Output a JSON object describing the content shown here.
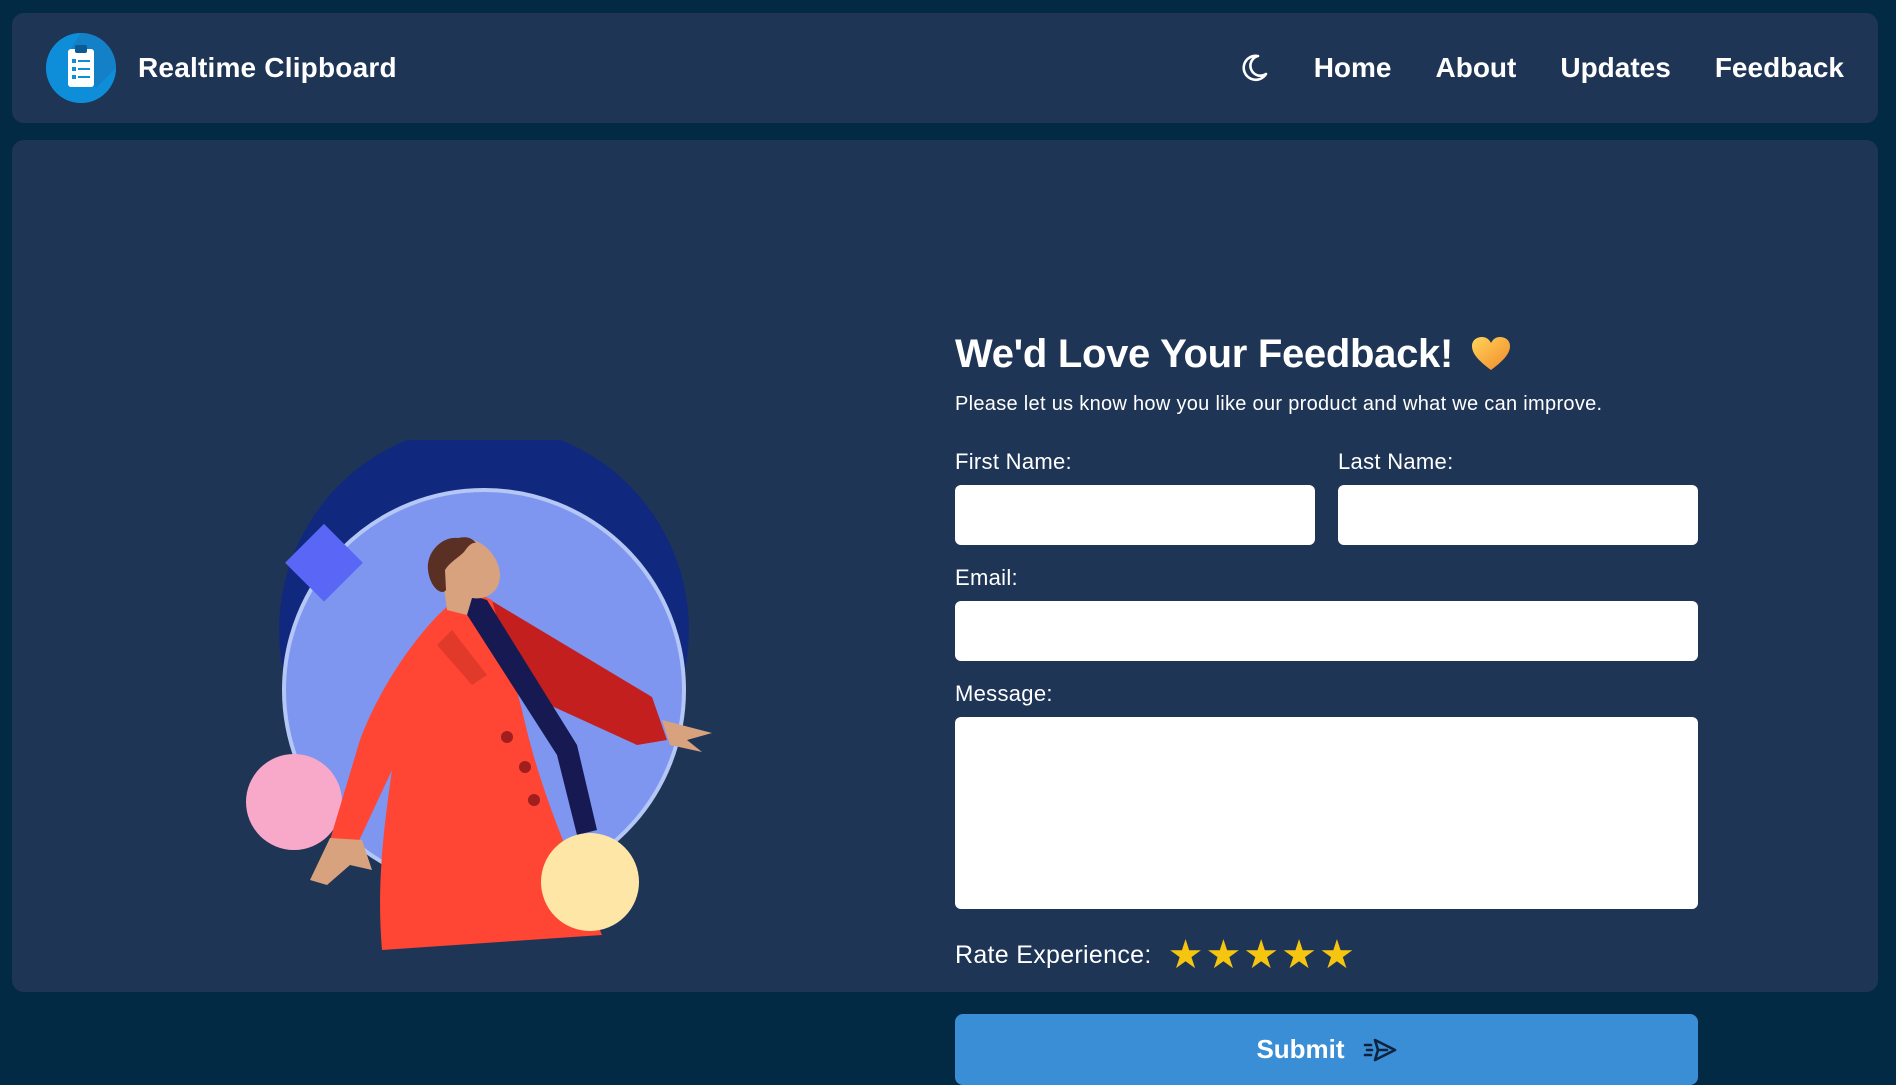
{
  "header": {
    "brand_name": "Realtime Clipboard",
    "nav": [
      {
        "label": "Home"
      },
      {
        "label": "About"
      },
      {
        "label": "Updates"
      },
      {
        "label": "Feedback"
      }
    ],
    "theme_toggle_icon": "moon-icon",
    "logo_icon": "clipboard-icon"
  },
  "form": {
    "title": "We'd Love Your Feedback!",
    "title_icon": "heart-icon",
    "subtitle": "Please let us know how you like our product and what we can improve.",
    "first_name_label": "First Name:",
    "first_name_value": "",
    "last_name_label": "Last Name:",
    "last_name_value": "",
    "email_label": "Email:",
    "email_value": "",
    "message_label": "Message:",
    "message_value": "",
    "rating_label": "Rate Experience:",
    "rating_value": 5,
    "rating_max": 5,
    "submit_label": "Submit",
    "submit_icon": "send-icon"
  },
  "colors": {
    "page_background": "#022a45",
    "card_background": "#1f3556",
    "accent": "#3a8ed6",
    "star": "#f6c50f"
  }
}
